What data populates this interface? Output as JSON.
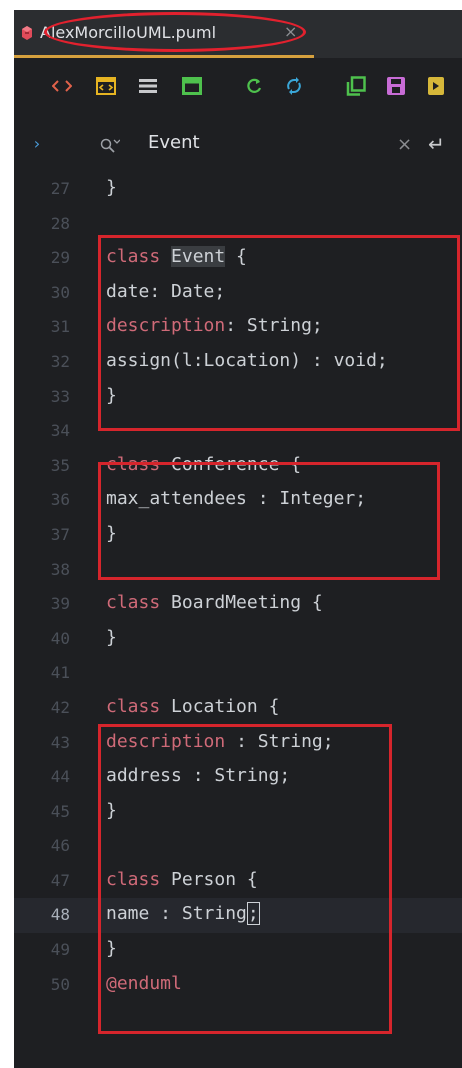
{
  "tab": {
    "filename": "AlexMorcilloUML.puml",
    "close_glyph": "×"
  },
  "toolbar": {
    "buttons": [
      {
        "name": "code-view-icon",
        "color": "#e2624b"
      },
      {
        "name": "split-view-icon",
        "color": "#e6b422"
      },
      {
        "name": "list-view-icon",
        "color": "#c8c9cc"
      },
      {
        "name": "preview-icon",
        "color": "#4ec14d"
      },
      {
        "name": "refresh-icon",
        "color": "#4ec14d"
      },
      {
        "name": "sync-icon",
        "color": "#3aa6d8"
      },
      {
        "name": "copy-icon",
        "color": "#4ec14d"
      },
      {
        "name": "save-icon",
        "color": "#c86cd6"
      },
      {
        "name": "export-icon",
        "color": "#d6b73a"
      }
    ]
  },
  "search": {
    "expand_glyph": "›",
    "query": "Event",
    "close_glyph": "×",
    "enter_glyph": "↵"
  },
  "colors": {
    "keyword": "#cf6a78",
    "text": "#cdd1d6",
    "box": "#d6252c",
    "ellipse": "#e2212e",
    "tab_underline": "#d6a13e"
  },
  "lines": [
    {
      "num": "27",
      "text": "}"
    },
    {
      "num": "28",
      "text": ""
    },
    {
      "num": "29",
      "kw": "class",
      "text": "Event",
      "tail": " {"
    },
    {
      "num": "30",
      "text": "date: Date;"
    },
    {
      "num": "31",
      "kw": "description",
      "text": ": String;"
    },
    {
      "num": "32",
      "text": "assign(l:Location) : void;"
    },
    {
      "num": "33",
      "text": "}"
    },
    {
      "num": "34",
      "text": ""
    },
    {
      "num": "35",
      "kw": "class",
      "text": "Conference {"
    },
    {
      "num": "36",
      "text": "max_attendees : Integer;"
    },
    {
      "num": "37",
      "text": "}"
    },
    {
      "num": "38",
      "text": ""
    },
    {
      "num": "39",
      "kw": "class",
      "text": "BoardMeeting {"
    },
    {
      "num": "40",
      "text": "}"
    },
    {
      "num": "41",
      "text": ""
    },
    {
      "num": "42",
      "kw": "class",
      "text": "Location {"
    },
    {
      "num": "43",
      "kw": "description",
      "text": ": String;"
    },
    {
      "num": "44",
      "text": "address : String;"
    },
    {
      "num": "45",
      "text": "}"
    },
    {
      "num": "46",
      "text": ""
    },
    {
      "num": "47",
      "kw": "class",
      "text": "Person {"
    },
    {
      "num": "48",
      "text": "name : String",
      "caret": ";"
    },
    {
      "num": "49",
      "text": "}"
    },
    {
      "num": "50",
      "kw": "@enduml",
      "text": ""
    }
  ]
}
